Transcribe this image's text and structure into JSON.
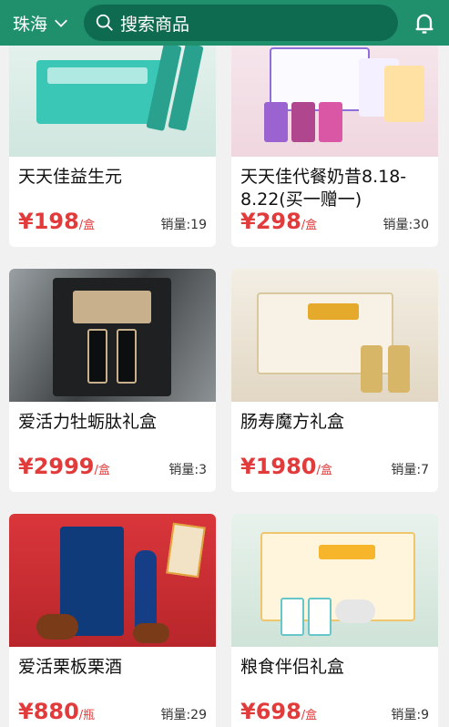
{
  "header": {
    "city": "珠海",
    "search_placeholder": "搜索商品"
  },
  "colors": {
    "brand_green": "#1f8f6c",
    "price_red": "#e23b3b"
  },
  "icons": {
    "city_dropdown": "chevron-down-icon",
    "search": "search-icon",
    "notifications": "bell-icon"
  },
  "products": [
    {
      "name": "天天佳益生元",
      "price": "¥198",
      "unit": "/盒",
      "sales": "销量:19"
    },
    {
      "name": "天天佳代餐奶昔8.18-8.22(买一赠一)",
      "price": "¥298",
      "unit": "/盒",
      "sales": "销量:30"
    },
    {
      "name": "爱活力牡蛎肽礼盒",
      "price": "¥2999",
      "unit": "/盒",
      "sales": "销量:3"
    },
    {
      "name": "肠寿魔方礼盒",
      "price": "¥1980",
      "unit": "/盒",
      "sales": "销量:7"
    },
    {
      "name": "爱活栗板栗酒",
      "price": "¥880",
      "unit": "/瓶",
      "sales": "销量:29"
    },
    {
      "name": "粮食伴侣礼盒",
      "price": "¥698",
      "unit": "/盒",
      "sales": "销量:9"
    }
  ]
}
